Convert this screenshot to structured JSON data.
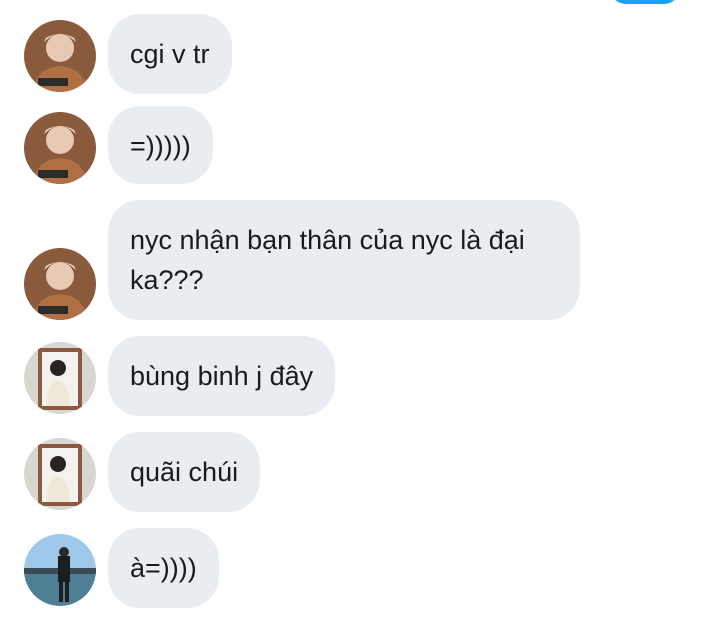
{
  "conversation": {
    "accent_color": "#1aa3f0",
    "bubble_color": "#e9edf2",
    "messages": [
      {
        "sender_avatar": "person-a-avatar",
        "text": "cgi v tr"
      },
      {
        "sender_avatar": "person-a-avatar",
        "text": "=)))))"
      },
      {
        "sender_avatar": "person-a-avatar",
        "text": "nyc nhận bạn thân của nyc là đại ka???"
      },
      {
        "sender_avatar": "person-b-avatar",
        "text": "bùng binh j đây"
      },
      {
        "sender_avatar": "person-b-avatar",
        "text": "quãi chúi"
      },
      {
        "sender_avatar": "person-c-avatar",
        "text": "à=))))"
      }
    ]
  }
}
